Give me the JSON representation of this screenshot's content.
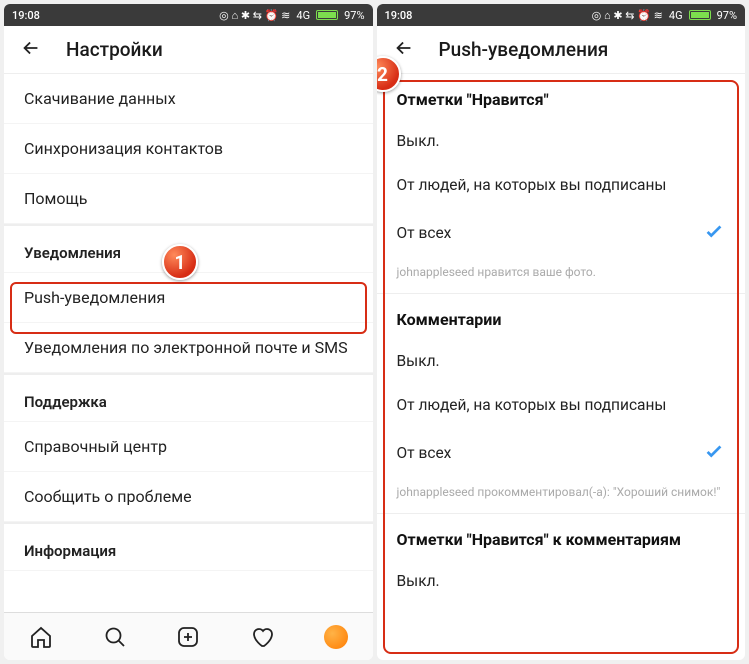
{
  "status": {
    "time": "19:08",
    "signal_icons": "◎ ⌂ ✱ ⇆ ⏰ ≋",
    "network": "4G",
    "battery": "97%"
  },
  "left": {
    "header_title": "Настройки",
    "rows": {
      "download_data": "Скачивание данных",
      "sync_contacts": "Синхронизация контактов",
      "help": "Помощь"
    },
    "sections": {
      "notifications": "Уведомления",
      "support": "Поддержка",
      "info": "Информация"
    },
    "notif_rows": {
      "push": "Push-уведомления",
      "email_sms": "Уведомления по электронной почте и SMS"
    },
    "support_rows": {
      "help_center": "Справочный центр",
      "report": "Сообщить о проблеме"
    }
  },
  "right": {
    "header_title": "Push-уведомления",
    "groups": {
      "likes": "Отметки \"Нравится\"",
      "comments": "Комментарии",
      "comment_likes": "Отметки \"Нравится\" к комментариям"
    },
    "options": {
      "off": "Выкл.",
      "from_following": "От людей, на которых вы подписаны",
      "from_all": "От всех"
    },
    "hints": {
      "likes": "johnappleseed нравится ваше фото.",
      "comments": "johnappleseed прокомментировал(-a): \"Хороший снимок!\""
    }
  },
  "markers": {
    "one": "1",
    "two": "2"
  }
}
